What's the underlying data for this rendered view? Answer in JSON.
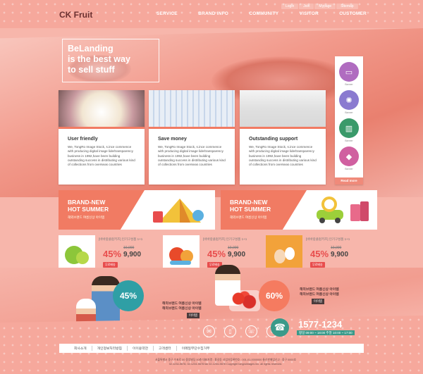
{
  "header": {
    "logo": "CK Fruit",
    "topbar": [
      "Login",
      "Join",
      "Mypage",
      "Sitemap"
    ],
    "nav": [
      "SERVICE",
      "BRAND INFO",
      "COMMUNITY",
      "VISITOR",
      "CUSTOMER"
    ]
  },
  "hero": {
    "line1": "BeLanding",
    "line2": "is the best way",
    "line3": "to sell stuff"
  },
  "cards": [
    {
      "title": "User friendly",
      "body": "We, TongRo Image Stock, s.ince commence with producing digital image lide/transparency business in 1992,have been building outstanding success in distributing various kind of collections from overseas countries"
    },
    {
      "title": "Save money",
      "body": "We, TongRo Image Stock, s.ince commence with producing digital image lide/transparency business in 1992,have been building outstanding success in distributing various kind of collections from overseas countries"
    },
    {
      "title": "Outstanding support",
      "body": "We, TongRo Image Stock, s.ince commence with producing digital image lide/transparency business in 1992,have been building outstanding success in distributing various kind of collections from overseas countries"
    }
  ],
  "side": {
    "items": [
      "Banner",
      "Banner",
      "Banner",
      "Banner"
    ],
    "more": "Read more"
  },
  "banners": [
    {
      "line1": "BRAND-NEW",
      "line2": "HOT SUMMER",
      "sub": "해외브랜드 여름신상 아이템"
    },
    {
      "line1": "BRAND-NEW",
      "line2": "HOT SUMMER",
      "sub": "해외브랜드 여름신상 아이템"
    }
  ],
  "products": [
    {
      "desc": "[바바랑클럽키즈] 인기구성품 1+1",
      "old": "10,000",
      "pct": "45%",
      "price": "9,900",
      "tag": "무료배송"
    },
    {
      "desc": "[바바랑클럽키즈] 인기구성품 1+1",
      "old": "10,000",
      "pct": "45%",
      "price": "9,900",
      "tag": "무료배송"
    },
    {
      "desc": "[바바랑클럽키즈] 인기구성품 1+1",
      "old": "10,000",
      "pct": "45%",
      "price": "9,900",
      "tag": "무료배송"
    }
  ],
  "promo": [
    {
      "pct": "45%",
      "line1": "해외브랜드 여름신상 아이템",
      "line2": "해외브랜드 여름신상 아이템",
      "btn": "이이템"
    },
    {
      "pct": "60%",
      "line1": "해외브랜드 여름신상 아이템",
      "line2": "해외브랜드 여름신상 아이템",
      "btn": "이이템"
    }
  ],
  "cs": {
    "number": "1577-1234",
    "hours": "평일 09:00 ~ 18:00  주말 10:00 ~ 17:00"
  },
  "footer": {
    "links": [
      "회사소개",
      "개인정보처리방침",
      "이이용약관",
      "고객센터",
      "이메일무단수집거부"
    ],
    "info1": "서울특별시 중구 수표로 00 중앙빌딩 00층  대표자명 : 홍길동  사업자등록번호 : 001-01-0000000  통신판매업신고 : 중구 0000호",
    "info2": "02-1234-5678, 02-1234-5678  fax 02-1234-5678  Copyright tongroimages inc. all rights reserved."
  },
  "colors": {
    "accent": "#f17b63",
    "teal": "#2f9fa5",
    "price_red": "#e84d4d"
  }
}
